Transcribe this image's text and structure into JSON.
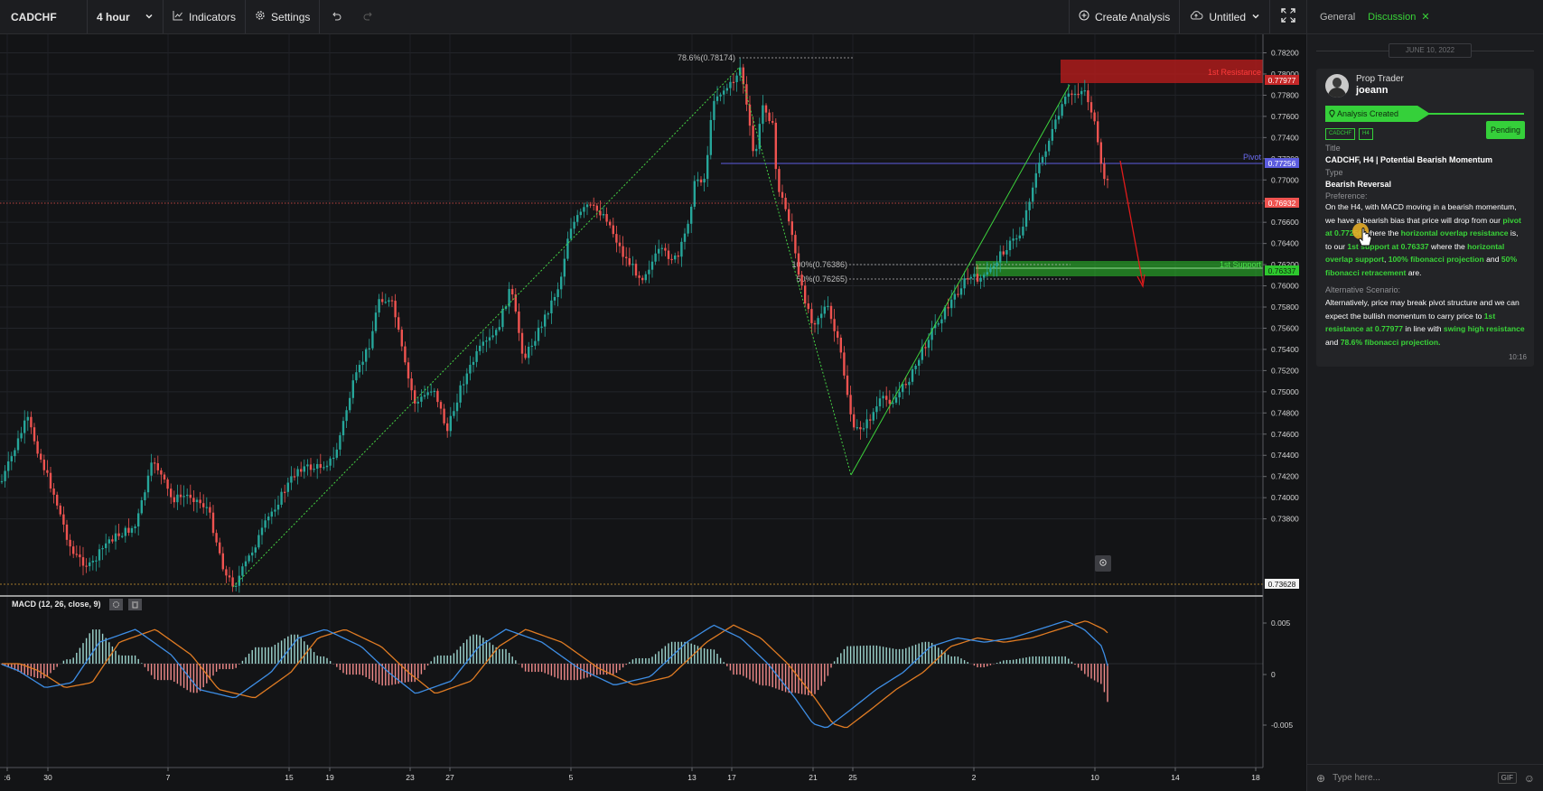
{
  "toolbar": {
    "symbol": "CADCHF",
    "interval": "4 hour",
    "indicators_label": "Indicators",
    "settings_label": "Settings",
    "create_analysis_label": "Create Analysis",
    "layout_label": "Untitled"
  },
  "colors": {
    "bull": "#26a69a",
    "bear": "#ef5350",
    "accent_green": "#39d338",
    "resistance_zone": "#c62828",
    "support_zone": "#2ec82e",
    "pivot_line": "#5c5ce0"
  },
  "chart": {
    "price_axis_ticks": [
      "0.78200",
      "0.78000",
      "0.77800",
      "0.77600",
      "0.77400",
      "0.77200",
      "0.77000",
      "0.76800",
      "0.76600",
      "0.76400",
      "0.76200",
      "0.76000",
      "0.75800",
      "0.75600",
      "0.75400",
      "0.75200",
      "0.75000",
      "0.74800",
      "0.74600",
      "0.74400",
      "0.74200",
      "0.74000",
      "0.73800"
    ],
    "time_axis_ticks": [
      ":6",
      "30",
      "7",
      "15",
      "19",
      "23",
      "27",
      "5",
      "13",
      "17",
      "21",
      "25",
      "2",
      "10",
      "14",
      "18"
    ],
    "price_badges": {
      "resistance": "0.77977",
      "pivot": "0.77256",
      "current": "0.76932",
      "support": "0.76337",
      "low": "0.73628"
    },
    "zone_labels": {
      "resistance": "1st Resistance",
      "pivot": "Pivot",
      "support": "1st Support"
    },
    "fib_labels": {
      "fib786": "78.6%(0.78174)",
      "fib100": "100%(0.76386)",
      "fib50": "50%(0.76265)"
    },
    "macd": {
      "label": "MACD (12, 26, close, 9)",
      "ticks": [
        "0.005",
        "0",
        "-0.005"
      ]
    }
  },
  "panel": {
    "tabs": {
      "general": "General",
      "discussion": "Discussion"
    },
    "date": "JUNE 10, 2022",
    "author_role": "Prop Trader",
    "author_name": "joeann",
    "created_label": "Analysis Created",
    "tags": [
      "CADCHF",
      "H4"
    ],
    "status": "Pending",
    "title_label": "Title",
    "title_value": "CADCHF, H4 | Potential Bearish Momentum",
    "type_label": "Type",
    "type_value": "Bearish Reversal",
    "preference_label": "Preference:",
    "pref_text": {
      "p1": "On the H4, with MACD moving in a bearish momentum, we have a bearish bias that price will drop from our ",
      "h1": "pivot at 0.77256",
      "p2": " where the ",
      "h2": "horizontal overlap resistance",
      "p3": " is, to our ",
      "h3": "1st support at 0.76337",
      "p4": " where the ",
      "h4": "horizontal overlap support",
      "p5": ", ",
      "h5": "100% fibonacci projection",
      "p6": " and ",
      "h6": "50% fibonacci retracement",
      "p7": " are."
    },
    "alternative_label": "Alternative Scenario:",
    "alt_text": {
      "p1": "Alternatively, price may break pivot structure and we can expect the bullish momentum to carry price to ",
      "h1": "1st resistance at 0.77977",
      "p2": " in line with ",
      "h2": "swing high resistance",
      "p3": " and ",
      "h3": "78.6% fibonacci projection.",
      "p4": ""
    },
    "time": "10:16",
    "input_placeholder": "Type here...",
    "gif_label": "GIF"
  }
}
